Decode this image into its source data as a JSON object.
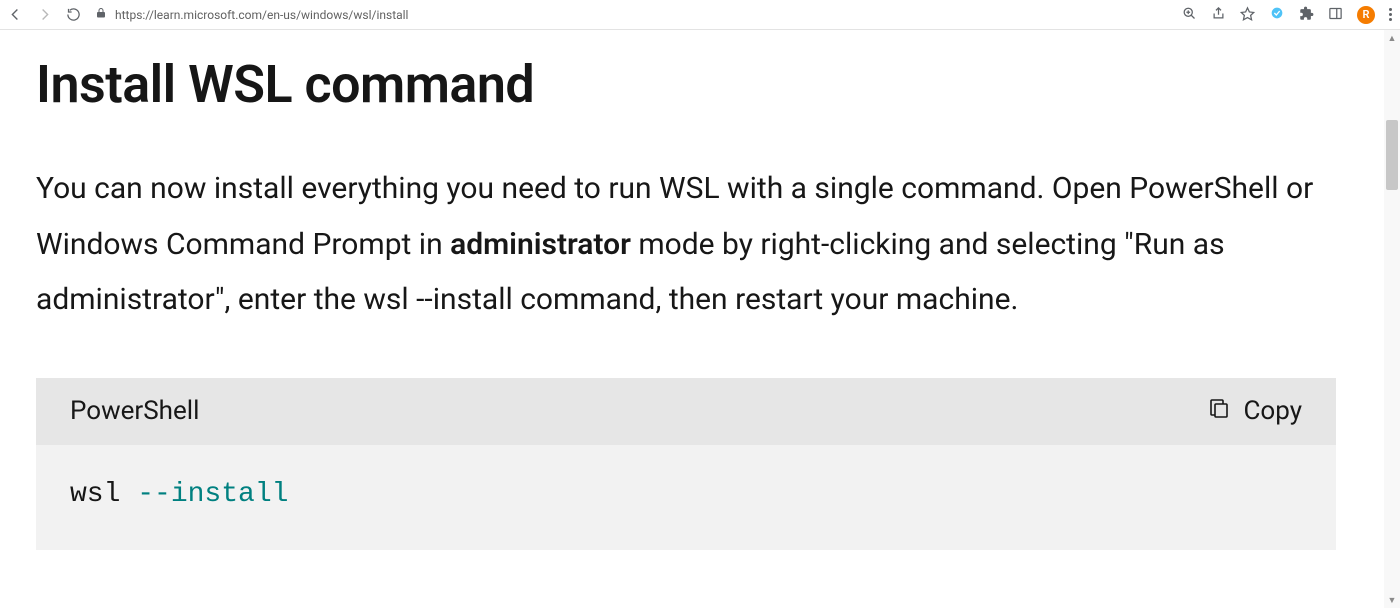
{
  "browser": {
    "url": "https://learn.microsoft.com/en-us/windows/wsl/install",
    "avatar_letter": "R"
  },
  "page": {
    "heading": "Install WSL command",
    "para_pre": "You can now install everything you need to run WSL with a single command. Open PowerShell or Windows Command Prompt in ",
    "para_strong": "administrator",
    "para_post": " mode by right-clicking and selecting \"Run as administrator\", enter the wsl --install command, then restart your machine."
  },
  "codeblock": {
    "language": "PowerShell",
    "copy_label": "Copy",
    "cmd": "wsl ",
    "flag": "--install"
  }
}
